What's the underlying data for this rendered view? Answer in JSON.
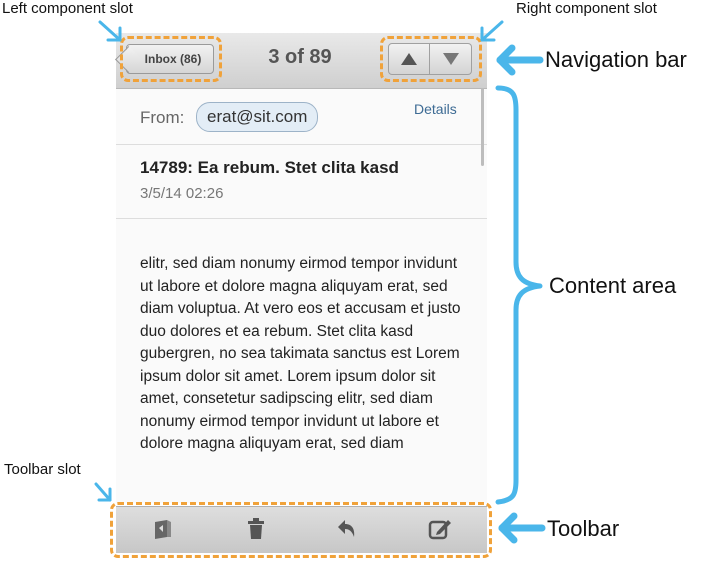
{
  "annotations": {
    "left_component_slot": "Left component slot",
    "right_component_slot": "Right component slot",
    "navigation_bar": "Navigation bar",
    "content_area": "Content area",
    "toolbar_slot": "Toolbar slot",
    "toolbar": "Toolbar"
  },
  "colors": {
    "slot_outline": "#f0a23a",
    "callout_arrow": "#4ab6ea"
  },
  "nav": {
    "back_label": "Inbox (86)",
    "title": "3 of 89",
    "up_icon": "triangle-up-icon",
    "down_icon": "triangle-down-icon"
  },
  "message": {
    "from_label": "From:",
    "from_address": "erat@sit.com",
    "details_link": "Details",
    "subject": "14789: Ea rebum. Stet clita kasd",
    "date": "3/5/14 02:26",
    "body": "elitr, sed diam nonumy eirmod tempor invidunt ut labore et dolore magna aliquyam erat, sed diam voluptua. At vero eos et accusam et justo duo dolores et ea rebum. Stet clita kasd gubergren, no sea takimata sanctus est Lorem ipsum dolor sit amet. Lorem ipsum dolor sit amet, consetetur sadipscing elitr, sed diam nonumy eirmod tempor invidunt ut labore et dolore magna aliquyam erat, sed diam"
  },
  "toolbar": {
    "icons": [
      "folder-move-icon",
      "trash-icon",
      "reply-icon",
      "compose-icon"
    ]
  }
}
